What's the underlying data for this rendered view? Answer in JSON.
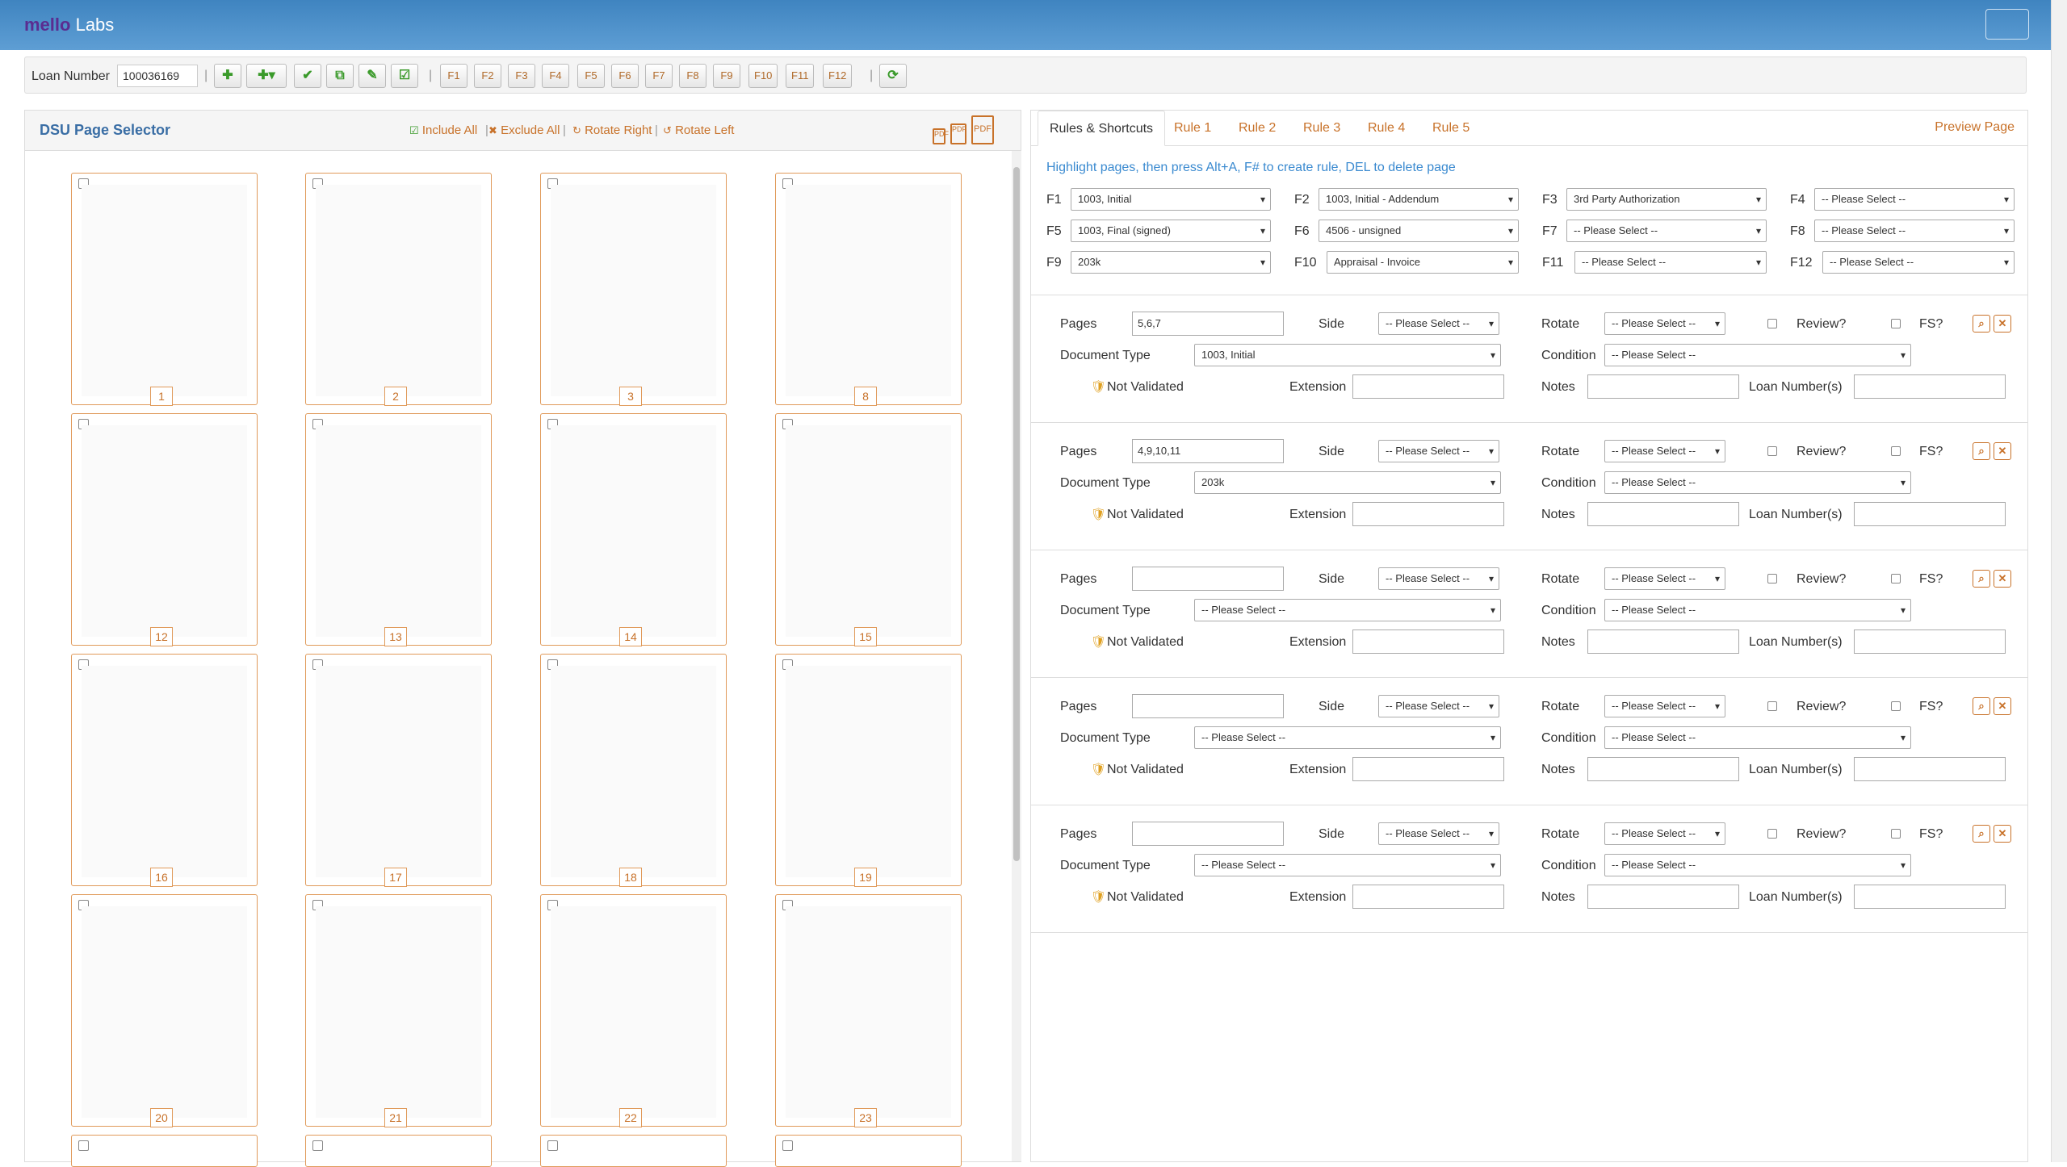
{
  "app": {
    "brand_prefix": "mello",
    "brand_suffix": " Labs"
  },
  "toolbar": {
    "loan_label": "Loan Number",
    "loan_value": "100036169",
    "fkeys": [
      "F1",
      "F2",
      "F3",
      "F4",
      "F5",
      "F6",
      "F7",
      "F8",
      "F9",
      "F10",
      "F11",
      "F12"
    ]
  },
  "selector": {
    "title": "DSU Page Selector",
    "include_all": "Include All",
    "exclude_all": "Exclude All",
    "rotate_right": "Rotate Right",
    "rotate_left": "Rotate Left",
    "pages": [
      "1",
      "2",
      "3",
      "8",
      "12",
      "13",
      "14",
      "15",
      "16",
      "17",
      "18",
      "19",
      "20",
      "21",
      "22",
      "23"
    ]
  },
  "tabs": [
    "Rules & Shortcuts",
    "Rule 1",
    "Rule 2",
    "Rule 3",
    "Rule 4",
    "Rule 5"
  ],
  "preview_label": "Preview Page",
  "hint": "Highlight pages, then press Alt+A, F# to create rule, DEL to delete page",
  "shortcuts": [
    {
      "key": "F1",
      "value": "1003, Initial"
    },
    {
      "key": "F2",
      "value": "1003, Initial - Addendum"
    },
    {
      "key": "F3",
      "value": "3rd Party Authorization"
    },
    {
      "key": "F4",
      "value": "-- Please Select --"
    },
    {
      "key": "F5",
      "value": "1003, Final (signed)"
    },
    {
      "key": "F6",
      "value": "4506 - unsigned"
    },
    {
      "key": "F7",
      "value": "-- Please Select --"
    },
    {
      "key": "F8",
      "value": "-- Please Select --"
    },
    {
      "key": "F9",
      "value": "203k"
    },
    {
      "key": "F10",
      "value": "Appraisal - Invoice"
    },
    {
      "key": "F11",
      "value": "-- Please Select --"
    },
    {
      "key": "F12",
      "value": "-- Please Select --"
    }
  ],
  "labels": {
    "pages": "Pages",
    "side": "Side",
    "rotate": "Rotate",
    "review": "Review?",
    "fs": "FS?",
    "doc_type": "Document Type",
    "condition": "Condition",
    "not_validated": "Not Validated",
    "extension": "Extension",
    "notes": "Notes",
    "loan_numbers": "Loan Number(s)",
    "please_select": "-- Please Select --"
  },
  "rules": [
    {
      "pages": "5,6,7",
      "doc_type": "1003, Initial"
    },
    {
      "pages": "4,9,10,11",
      "doc_type": "203k"
    },
    {
      "pages": "",
      "doc_type": "-- Please Select --"
    },
    {
      "pages": "",
      "doc_type": "-- Please Select --"
    },
    {
      "pages": "",
      "doc_type": "-- Please Select --"
    }
  ]
}
